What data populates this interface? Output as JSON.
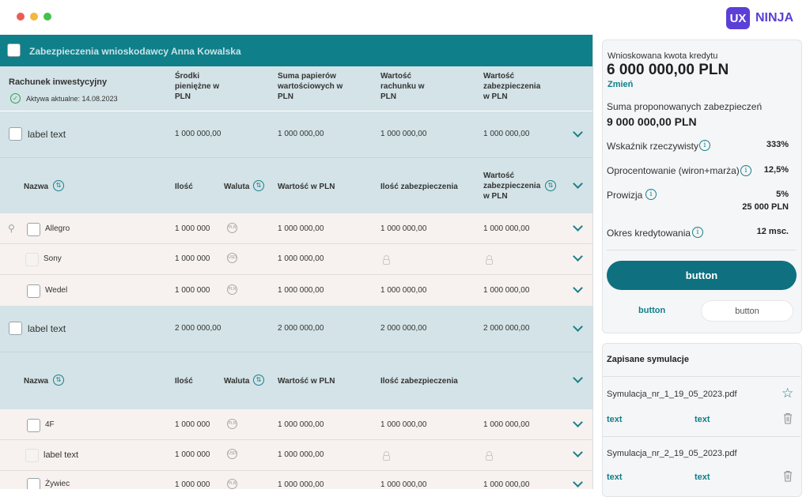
{
  "logo": {
    "box": "UX",
    "text": "NINJA"
  },
  "colors": {
    "teal": "#0f7f8a",
    "band": "#d3e3e7",
    "row": "#f7f2ef",
    "brand": "#5b3fd6"
  },
  "table": {
    "title": "Zabezpieczenia wnioskodawcy Anna Kowalska",
    "account_label": "Rachunek inwestycyjny",
    "assets_updated": "Aktywa aktualne: 14.08.2023",
    "summary_headers": [
      "Środki pieniężne w PLN",
      "Suma papierów wartościowych w PLN",
      "Wartość rachunku w PLN",
      "Wartość zabezpieczenia w PLN"
    ],
    "groups": [
      {
        "label": "label text",
        "values": [
          "1 000 000,00",
          "1 000 000,00",
          "1 000 000,00",
          "1 000 000,00"
        ],
        "cols": {
          "name": "Nazwa",
          "qty": "Ilość",
          "currency": "Waluta",
          "value": "Wartość w PLN",
          "qty_sec": "Ilość zabezpieczenia",
          "sec_value": "Wartość zabezpieczenia w PLN"
        },
        "rows": [
          {
            "name": "Allegro",
            "qty": "1 000 000",
            "cur": "PLN",
            "value": "1 000 000,00",
            "qty_sec": "1 000 000,00",
            "sec_value": "1 000 000,00"
          },
          {
            "name": "Sony",
            "qty": "1 000 000",
            "cur": "USD",
            "value": "1 000 000,00",
            "qty_sec": "",
            "sec_value": ""
          },
          {
            "name": "Wedel",
            "qty": "1 000 000",
            "cur": "PLN",
            "value": "1 000 000,00",
            "qty_sec": "1 000 000,00",
            "sec_value": "1 000 000,00"
          }
        ]
      },
      {
        "label": "label text",
        "values": [
          "2 000 000,00",
          "2 000 000,00",
          "2 000 000,00",
          "2 000 000,00"
        ],
        "cols": {
          "name": "Nazwa",
          "qty": "Ilość",
          "currency": "Waluta",
          "value": "Wartość w PLN",
          "qty_sec": "Ilość zabezpieczenia"
        },
        "rows": [
          {
            "name": "4F",
            "qty": "1 000 000",
            "cur": "PLN",
            "value": "1 000 000,00",
            "qty_sec": "1 000 000,00",
            "sec_value": "1 000 000,00"
          },
          {
            "name": "label text",
            "qty": "1 000 000",
            "cur": "USD",
            "value": "1 000 000,00",
            "qty_sec": "",
            "sec_value": ""
          },
          {
            "name": "Żywiec",
            "qty": "1 000 000",
            "cur": "PLN",
            "value": "1 000 000,00",
            "qty_sec": "1 000 000,00",
            "sec_value": "1 000 000,00"
          }
        ]
      }
    ]
  },
  "summary": {
    "requested_label": "Wnioskowana kwota kredytu",
    "requested_value": "6 000 000,00 PLN",
    "change": "Zmień",
    "proposed_label": "Suma proponowanych zabezpieczeń",
    "proposed_value": "9 000 000,00 PLN",
    "ratio_label": "Wskaźnik rzeczywisty",
    "ratio_value": "333%",
    "rate_label": "Oprocentowanie (wiron+marża)",
    "rate_value": "12,5%",
    "fee_label": "Prowizja",
    "fee_pct": "5%",
    "fee_amount": "25 000 PLN",
    "period_label": "Okres kredytowania",
    "period_value": "12 msc.",
    "main_button": "button",
    "link_button": "button",
    "secondary_button": "button"
  },
  "saved": {
    "title": "Zapisane symulacje",
    "items": [
      {
        "file": "Symulacja_nr_1_19_05_2023.pdf",
        "text1": "text",
        "text2": "text"
      },
      {
        "file": "Symulacja_nr_2_19_05_2023.pdf",
        "text1": "text",
        "text2": "text"
      }
    ]
  }
}
